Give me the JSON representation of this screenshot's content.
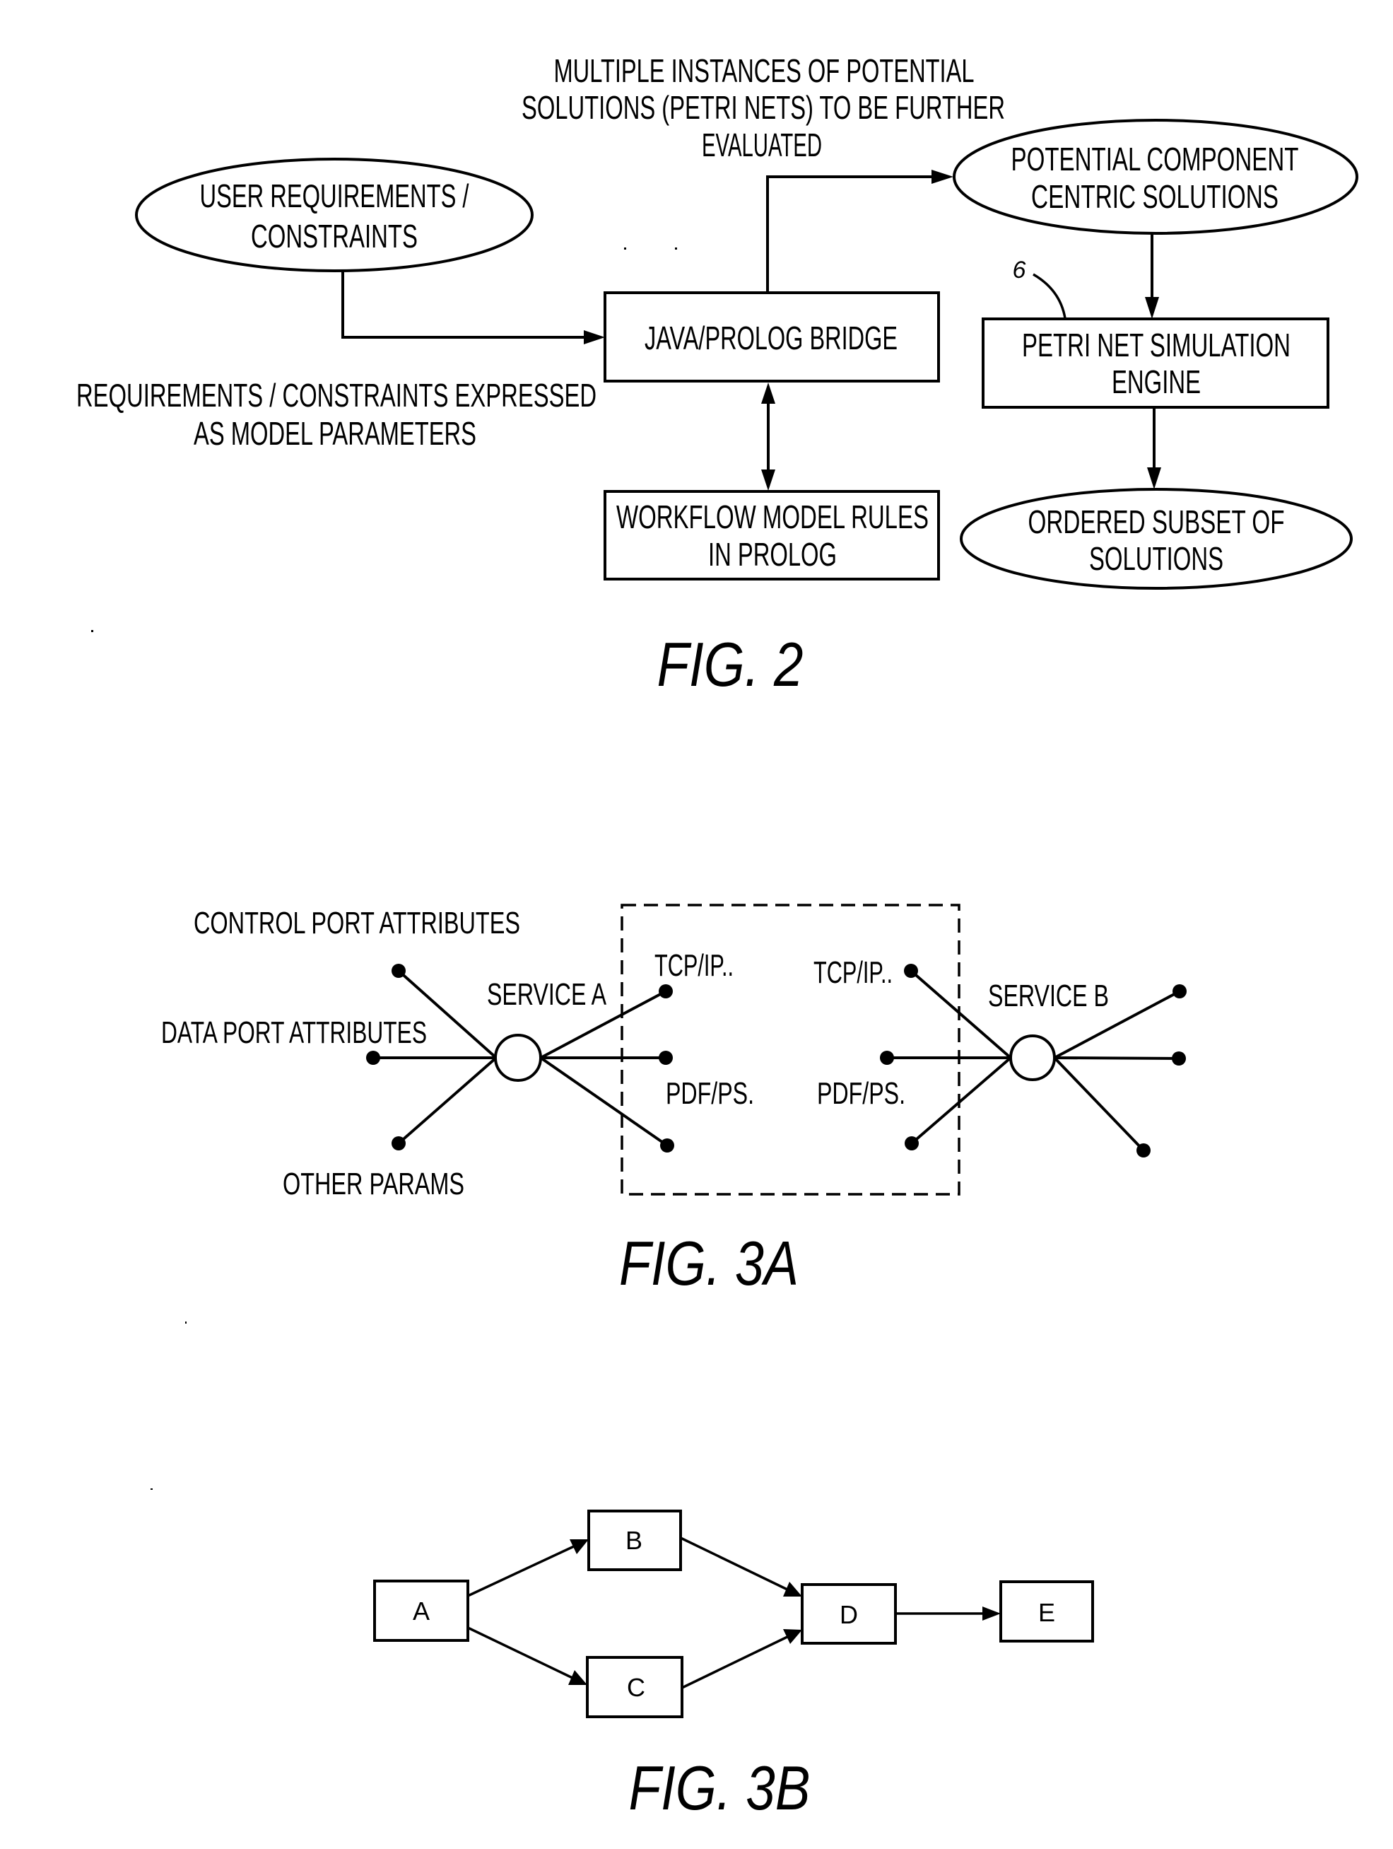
{
  "figures": {
    "fig2": {
      "caption": "FIG. 2",
      "annotation_top": {
        "lines": [
          "MULTIPLE INSTANCES OF POTENTIAL",
          "SOLUTIONS (PETRI NETS) TO BE FURTHER",
          "EVALUATED"
        ]
      },
      "annotation_left": {
        "lines": [
          "REQUIREMENTS / CONSTRAINTS EXPRESSED",
          "AS MODEL PARAMETERS"
        ]
      },
      "nodes": {
        "user_requirements": {
          "shape": "ellipse",
          "lines": [
            "USER REQUIREMENTS /",
            "CONSTRAINTS"
          ]
        },
        "java_prolog_bridge": {
          "shape": "box",
          "lines": [
            "JAVA/PROLOG BRIDGE"
          ]
        },
        "workflow_model_rules": {
          "shape": "box",
          "lines": [
            "WORKFLOW MODEL RULES",
            "IN PROLOG"
          ]
        },
        "potential_solutions": {
          "shape": "ellipse",
          "lines": [
            "POTENTIAL COMPONENT",
            "CENTRIC SOLUTIONS"
          ]
        },
        "petri_net_engine": {
          "shape": "box",
          "lines": [
            "PETRI NET SIMULATION",
            "ENGINE"
          ],
          "reference_numeral": "6"
        },
        "ordered_subset": {
          "shape": "ellipse",
          "lines": [
            "ORDERED SUBSET OF",
            "SOLUTIONS"
          ]
        }
      },
      "edges": [
        {
          "from": "user_requirements",
          "to": "java_prolog_bridge",
          "type": "arrow"
        },
        {
          "from": "java_prolog_bridge",
          "to": "potential_solutions",
          "type": "arrow"
        },
        {
          "from": "java_prolog_bridge",
          "to": "workflow_model_rules",
          "type": "bidirectional"
        },
        {
          "from": "potential_solutions",
          "to": "petri_net_engine",
          "type": "arrow"
        },
        {
          "from": "petri_net_engine",
          "to": "ordered_subset",
          "type": "arrow"
        }
      ]
    },
    "fig3a": {
      "caption": "FIG. 3A",
      "labels": {
        "control_port": "CONTROL PORT ATTRIBUTES",
        "data_port": "DATA PORT ATTRIBUTES",
        "other_params": "OTHER PARAMS",
        "service_a": "SERVICE A",
        "service_b": "SERVICE B",
        "tcp_a": "TCP/IP..",
        "pdf_a": "PDF/PS.",
        "tcp_b": "TCP/IP..",
        "pdf_b": "PDF/PS."
      },
      "services": [
        {
          "name": "SERVICE A",
          "input_ports": 3,
          "output_ports": 3
        },
        {
          "name": "SERVICE B",
          "input_ports": 3,
          "output_ports": 3
        }
      ],
      "interface_region": "dashed"
    },
    "fig3b": {
      "caption": "FIG. 3B",
      "nodes": [
        "A",
        "B",
        "C",
        "D",
        "E"
      ],
      "edges": [
        {
          "from": "A",
          "to": "B"
        },
        {
          "from": "A",
          "to": "C"
        },
        {
          "from": "B",
          "to": "D"
        },
        {
          "from": "C",
          "to": "D"
        },
        {
          "from": "D",
          "to": "E"
        }
      ]
    }
  }
}
